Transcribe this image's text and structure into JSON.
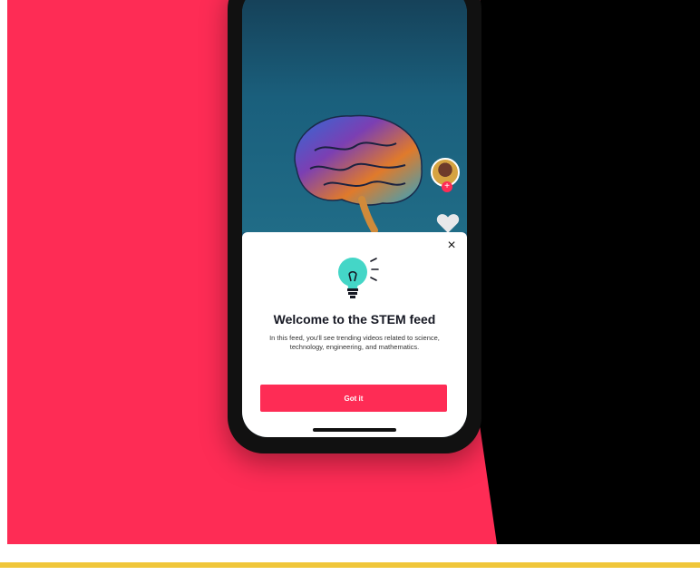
{
  "modal": {
    "title": "Welcome to the STEM feed",
    "description": "In this feed, you'll see trending videos related to science, technology, engineering, and mathematics.",
    "button_label": "Got it",
    "close_glyph": "×"
  },
  "sidebar": {
    "follow_badge_glyph": "+"
  },
  "icons": {
    "brain": "brain-image",
    "heart": "heart-icon",
    "lightbulb": "lightbulb-icon",
    "close": "close-icon"
  },
  "colors": {
    "accent": "#fe2c55",
    "background_left": "#fe2c55",
    "background_right": "#000000",
    "stripe": "#f0c63a",
    "video_bg": "#1a5f7c",
    "bulb": "#44d6c7"
  }
}
